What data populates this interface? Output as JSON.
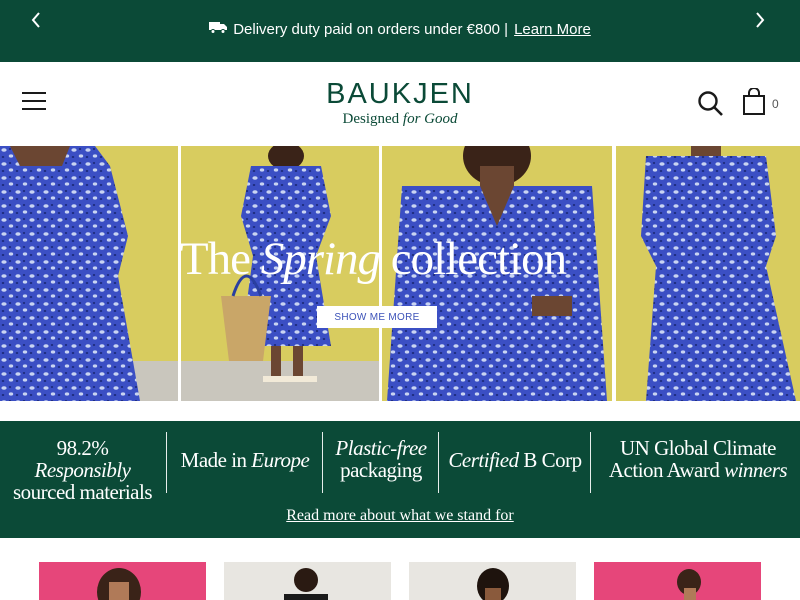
{
  "announcement": {
    "prev_icon": "chevron-left-icon",
    "next_icon": "chevron-right-icon",
    "delivery_icon": "truck-icon",
    "message": "Delivery duty paid on orders under €800 |",
    "link": "Learn More"
  },
  "header": {
    "menu_icon": "hamburger-icon",
    "brand": "BAUKJEN",
    "tagline_prefix": "Designed",
    "tagline_italic": "for Good",
    "search_icon": "search-icon",
    "cart_icon": "shopping-bag-icon",
    "cart_count": "0"
  },
  "hero": {
    "title_prefix": "The",
    "title_italic": "Spring",
    "title_suffix": "collection",
    "cta": "SHOW ME MORE"
  },
  "values": {
    "items": [
      {
        "line1": "98.2%",
        "line1_italic": "Responsibly",
        "line2": "sourced materials"
      },
      {
        "line1": "Made in",
        "line1_italic": "Europe",
        "line2": ""
      },
      {
        "line1": "",
        "line1_italic": "Plastic-free",
        "line2": "packaging"
      },
      {
        "line1": "B Corp",
        "line1_italic": "Certified",
        "line2": ""
      },
      {
        "line1": "UN Global Climate",
        "line1_italic": "",
        "line2": "Action Award",
        "line2_italic": "winners"
      }
    ],
    "link": "Read more about what we stand for"
  },
  "colors": {
    "brand_green": "#0b4a37",
    "hero_yellow": "#d8cc5f",
    "dress_blue": "#3b4fc4",
    "tile_pink": "#e6467a",
    "cta_text": "#3c52b8"
  }
}
